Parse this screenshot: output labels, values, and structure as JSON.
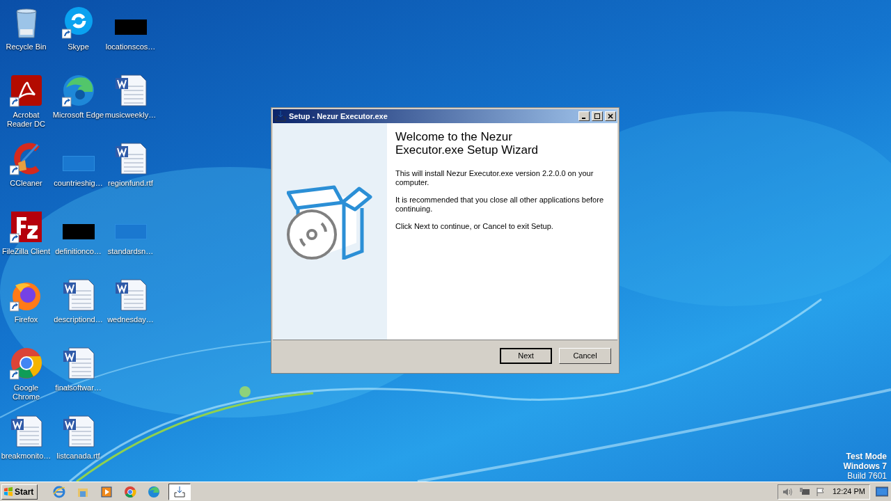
{
  "desktop": {
    "columns": [
      [
        {
          "label": "Recycle Bin",
          "kind": "recycle",
          "shortcut": false
        },
        {
          "label": "Acrobat Reader DC",
          "kind": "acrobat",
          "shortcut": true
        },
        {
          "label": "CCleaner",
          "kind": "ccleaner",
          "shortcut": true
        },
        {
          "label": "FileZilla Client",
          "kind": "filezilla",
          "shortcut": true
        },
        {
          "label": "Firefox",
          "kind": "firefox",
          "shortcut": true
        },
        {
          "label": "Google Chrome",
          "kind": "chrome",
          "shortcut": true
        },
        {
          "label": "breakmonito…",
          "kind": "word",
          "shortcut": false
        }
      ],
      [
        {
          "label": "Skype",
          "kind": "skype",
          "shortcut": true
        },
        {
          "label": "Microsoft Edge",
          "kind": "edge",
          "shortcut": true
        },
        {
          "label": "countrieshig…",
          "kind": "blank",
          "shortcut": false
        },
        {
          "label": "definitionco…",
          "kind": "dark",
          "shortcut": false
        },
        {
          "label": "descriptiond…",
          "kind": "word",
          "shortcut": false
        },
        {
          "label": "finalsoftwar…",
          "kind": "word",
          "shortcut": false
        },
        {
          "label": "listcanada.rtf",
          "kind": "word",
          "shortcut": false
        }
      ],
      [
        {
          "label": "locationscos…",
          "kind": "dark",
          "shortcut": false
        },
        {
          "label": "musicweekly…",
          "kind": "word",
          "shortcut": false
        },
        {
          "label": "regionfund.rtf",
          "kind": "word",
          "shortcut": false
        },
        {
          "label": "standardsn…",
          "kind": "blank",
          "shortcut": false
        },
        {
          "label": "wednesday…",
          "kind": "word",
          "shortcut": false
        }
      ]
    ]
  },
  "window": {
    "title": "Setup - Nezur Executor.exe",
    "heading": "Welcome to the Nezur Executor.exe Setup Wizard",
    "paragraphs": [
      "This will install Nezur Executor.exe version 2.2.0.0 on your computer.",
      "It is recommended that you close all other applications before continuing.",
      "Click Next to continue, or Cancel to exit Setup."
    ],
    "buttons": [
      {
        "label": "Next",
        "default": true
      },
      {
        "label": "Cancel",
        "default": false
      }
    ]
  },
  "watermark_text": [
    "Test Mode",
    "Windows 7",
    "Build 7601"
  ],
  "taskbar": {
    "start": "Start",
    "items": [
      {
        "kind": "ie",
        "active": false
      },
      {
        "kind": "explorer",
        "active": false
      },
      {
        "kind": "media",
        "active": false
      },
      {
        "kind": "chrome",
        "active": false
      },
      {
        "kind": "edge",
        "active": false
      },
      {
        "kind": "setup",
        "active": true
      }
    ],
    "clock": "12:24 PM"
  }
}
